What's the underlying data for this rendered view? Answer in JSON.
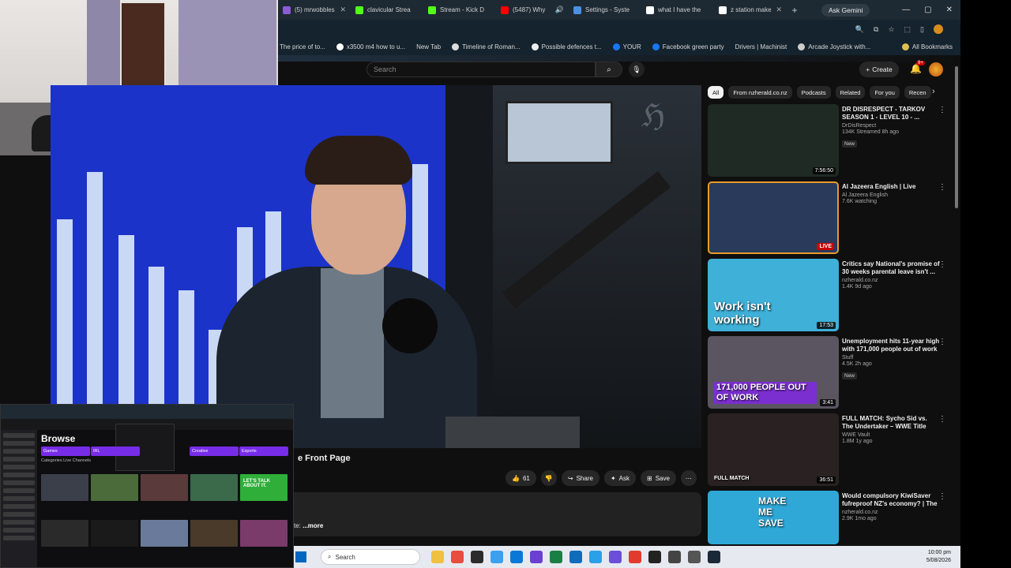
{
  "browser": {
    "tabs": [
      {
        "label": "(5) mrwobbles",
        "color": "#8c5cd6"
      },
      {
        "label": "clavicular Strea",
        "color": "#53fc18"
      },
      {
        "label": "Stream - Kick D",
        "color": "#53fc18"
      },
      {
        "label": "(5487) Why",
        "color": "#ff0000"
      },
      {
        "label": "Settings - Syste",
        "color": "#4a90e2"
      },
      {
        "label": "what I have the",
        "color": "#ffffff"
      },
      {
        "label": "z station make",
        "color": "#ffffff"
      }
    ],
    "new_tab_icon": "+",
    "ask_gemini": "Ask Gemini",
    "window_controls": [
      "—",
      "▢",
      "✕"
    ],
    "bookmarks": [
      "The price of to...",
      "x3500 m4 how to u...",
      "New Tab",
      "Timeline of Roman...",
      "Possible defences t...",
      "YOUR",
      "Facebook green party",
      "Drivers | Machinist",
      "Arcade Joystick with..."
    ],
    "all_bookmarks": "All Bookmarks"
  },
  "youtube": {
    "search_placeholder": "Search",
    "create_label": "Create",
    "notification_count": "9+",
    "video_title_partial": "e Front Page",
    "actions": {
      "likes": "61",
      "share": "Share",
      "ask": "Ask",
      "save": "Save"
    },
    "description_partial": "te:",
    "more_label": "...more",
    "chips": [
      "All",
      "From nzherald.co.nz",
      "Podcasts",
      "Related",
      "For you",
      "Recen"
    ],
    "recommendations": [
      {
        "title": "DR DISRESPECT - TARKOV SEASON 1 - LEVEL 10 - ...",
        "channel": "DrDisRespect",
        "meta": "134K  Streamed 8h ago",
        "badge": "New",
        "duration": "7:56:50",
        "thumb_color": "#1f2a24",
        "thumb_text": ""
      },
      {
        "title": "Al Jazeera English | Live",
        "channel": "Al Jazeera English",
        "meta": "7.6K watching",
        "badge": "",
        "duration": "LIVE",
        "thumb_color": "#2a3a5a",
        "thumb_text": ""
      },
      {
        "title": "Critics say National's promise of 30 weeks parental leave isn't ...",
        "channel": "nzherald.co.nz",
        "meta": "1.4K  9d ago",
        "badge": "",
        "duration": "17:53",
        "thumb_color": "#3fb0d8",
        "thumb_text": "Work isn't working"
      },
      {
        "title": "Unemployment hits 11-year high with 171,000 people out of work | ...",
        "channel": "Stuff",
        "meta": "4.5K  2h ago",
        "badge": "New",
        "duration": "3:41",
        "thumb_color": "#5a5560",
        "thumb_text": "171,000 PEOPLE OUT OF WORK"
      },
      {
        "title": "FULL MATCH: Sycho Sid vs. The Undertaker – WWE Title Match: ...",
        "channel": "WWE Vault",
        "meta": "1.8M  1y ago",
        "badge": "",
        "duration": "36:51",
        "thumb_color": "#2a2222",
        "thumb_text": "FULL MATCH"
      },
      {
        "title": "Would compulsory KiwiSaver fufreproof NZ's economy? | The ...",
        "channel": "nzherald.co.nz",
        "meta": "2.9K  1mo ago",
        "badge": "",
        "duration": "",
        "thumb_color": "#2fa8d8",
        "thumb_text": "MAKE ME SAVE"
      }
    ]
  },
  "twitch": {
    "browse_label": "Browse",
    "categories": [
      "Games",
      "IRL",
      "Creative",
      "Esports"
    ],
    "tabs_label": "Categories   Live Channels",
    "promo_text": "LET'S TALK ABOUT IT."
  },
  "taskbar": {
    "search_label": "Search",
    "time": "10:00 pm",
    "date": "5/08/2026",
    "icon_colors": [
      "#ffffff",
      "#e84d3d",
      "#2b2b2b",
      "#3aa0f0",
      "#0a78d6",
      "#6b3fd0",
      "#1a7f45",
      "#0f6cbd",
      "#2aa0e8",
      "#6b4fd6",
      "#e23b2e",
      "#222222",
      "#444",
      "#555",
      "#1b2838"
    ]
  }
}
